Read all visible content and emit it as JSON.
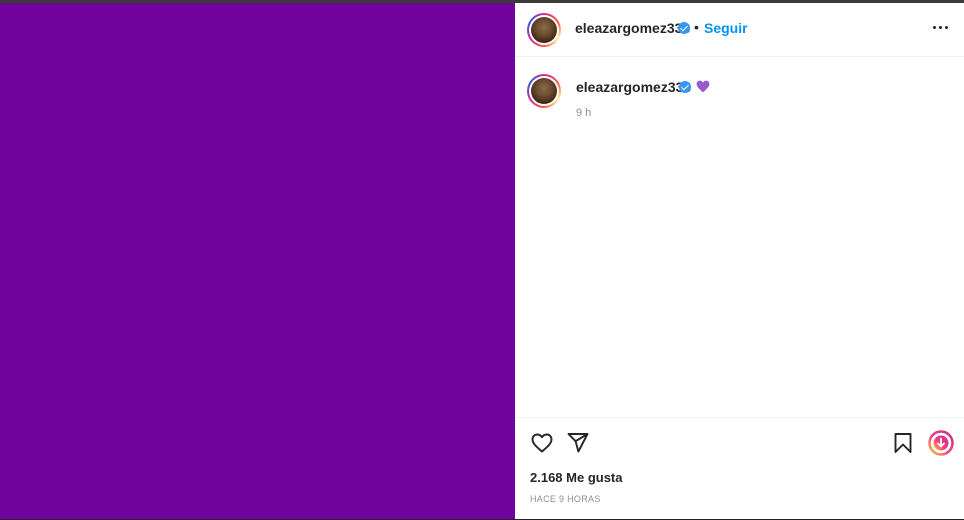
{
  "post": {
    "media_color": "#6f039b",
    "header": {
      "username": "eleazargomez333",
      "separator": "•",
      "follow_label": "Seguir"
    },
    "caption": {
      "username": "eleazargomez333",
      "emoji": "💜",
      "time": "9 h"
    },
    "footer": {
      "likes": "2.168 Me gusta",
      "timestamp": "HACE 9 HORAS"
    },
    "icons": {
      "like": "heart-outline-icon",
      "share": "paper-plane-icon",
      "save": "bookmark-icon",
      "extension": "download-extension-icon",
      "more": "more-options-icon",
      "verified": "verified-badge-icon"
    },
    "colors": {
      "accent": "#0095f6",
      "verified": "#3897f0"
    }
  }
}
